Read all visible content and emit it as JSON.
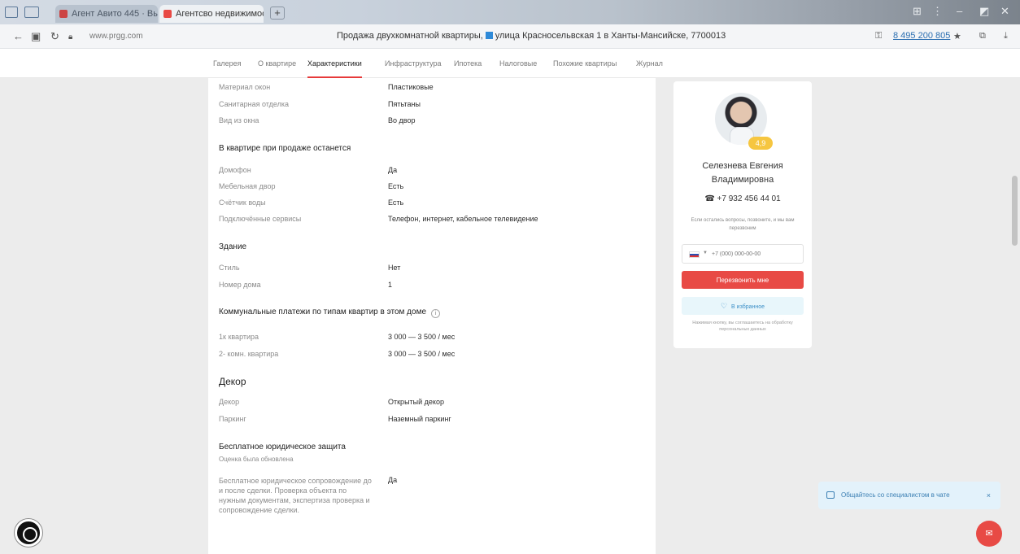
{
  "browser": {
    "tabs": [
      {
        "label": "Агент Авито 445 · Вы"
      },
      {
        "label": "Агентсво недвижимости · С"
      }
    ],
    "new_tab": "+",
    "window_controls": [
      "⊞",
      "⋮",
      "–",
      "◩",
      "✕"
    ],
    "url": "www.prgg.com",
    "page_title": "Продажа двухкомнатной квартиры,",
    "page_title_tail": "улица Красносельвская 1 в Ханты-Мансийске, 7700013",
    "right_text": "8 495 200 805"
  },
  "site_nav": {
    "tabs": [
      {
        "label": "Галерея"
      },
      {
        "label": "О квартире"
      },
      {
        "label": "Характеристики"
      },
      {
        "label": "Инфраструктура"
      },
      {
        "label": "Ипотека"
      },
      {
        "label": "Налоговые"
      },
      {
        "label": "Похожие квартиры"
      },
      {
        "label": "Журнал"
      }
    ],
    "active_index": 2
  },
  "details": {
    "top_rows": [
      {
        "key": "Материал окон",
        "value": "Пластиковые"
      },
      {
        "key": "Санитарная отделка",
        "value": "Пятьтаны"
      },
      {
        "key": "Вид из окна",
        "value": "Во двор"
      }
    ],
    "section_left": {
      "title": "В квартире при продаже останется",
      "rows": [
        {
          "key": "Домофон",
          "value": "Да"
        },
        {
          "key": "Мебельная двор",
          "value": "Есть"
        },
        {
          "key": "Счётчик воды",
          "value": "Есть"
        },
        {
          "key": "Подключённые сервисы",
          "value": "Телефон, интернет, кабельное телевидение"
        }
      ]
    },
    "section_building": {
      "title": "Здание",
      "rows": [
        {
          "key": "Стиль",
          "value": "Нет"
        },
        {
          "key": "Номер дома",
          "value": "1"
        }
      ]
    },
    "section_utilities": {
      "title": "Коммунальные платежи по типам квартир в этом доме",
      "rows": [
        {
          "key": "1к квартира",
          "value": "3 000 — 3 500 / мес"
        },
        {
          "key": "2- комн. квартира",
          "value": "3 000 — 3 500 / мес"
        }
      ]
    },
    "section_decor": {
      "title": "Декор",
      "rows": [
        {
          "key": "Декор",
          "value": "Открытый декор"
        },
        {
          "key": "Паркинг",
          "value": "Наземный паркинг"
        }
      ]
    },
    "section_legal": {
      "title": "Бесплатное юридическое защита",
      "subtitle": "Оценка была обновлена",
      "rows": [
        {
          "key": "Бесплатное юридическое сопровождение до и после сделки. Проверка объекта по нужным документам, экспертиза проверка и сопровождение сделки.",
          "value": "Да"
        }
      ]
    }
  },
  "agent": {
    "rating": "4,9",
    "name": "Селезнева Евгения Владимировна",
    "phone": "☎ +7 932 456 44 01",
    "note": "Если остались вопросы, позвоните, и мы вам перезвоним",
    "phone_placeholder": "+7 (000) 000-00-00",
    "call_label": "Перезвонить мне",
    "favorite_label": "В избранное",
    "consent": "Нажимая кнопку, вы соглашаетесь на обработку персональных данных"
  },
  "widgets": {
    "chat_prompt": "Общайтесь со специалистом в чате",
    "chat_close": "×",
    "chat_fab": "✉"
  },
  "colors": {
    "accent": "#e84a45",
    "tab_underline": "#e73a3a",
    "link_blue": "#3c8fc7"
  }
}
